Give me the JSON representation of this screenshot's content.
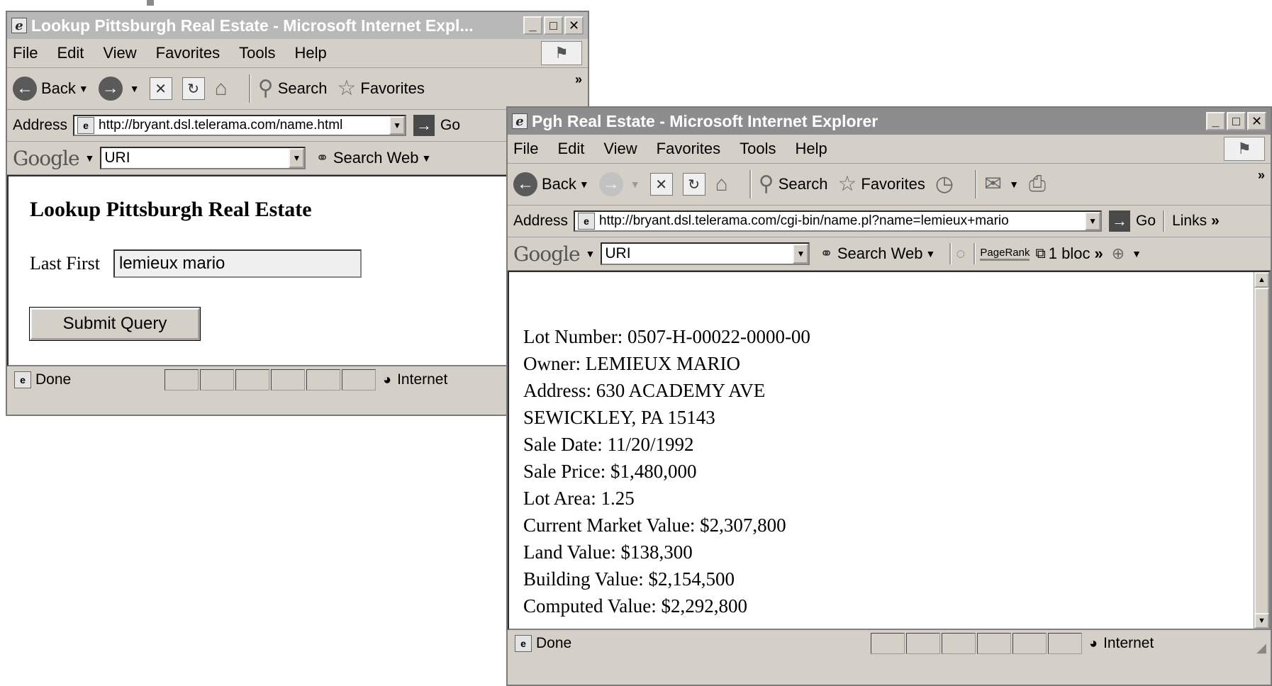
{
  "window1": {
    "title": "Lookup Pittsburgh Real Estate - Microsoft Internet Expl...",
    "menu": [
      "File",
      "Edit",
      "View",
      "Favorites",
      "Tools",
      "Help"
    ],
    "toolbar": {
      "back": "Back",
      "search": "Search",
      "favorites": "Favorites"
    },
    "address_label": "Address",
    "address_url": "http://bryant.dsl.telerama.com/name.html",
    "go_label": "Go",
    "google": {
      "logo": "Google",
      "query": "URI",
      "search_web": "Search Web"
    },
    "page": {
      "heading": "Lookup Pittsburgh Real Estate",
      "field_label": "Last First",
      "field_value": "lemieux mario",
      "submit_label": "Submit Query"
    },
    "status": {
      "text": "Done",
      "zone": "Internet"
    }
  },
  "window2": {
    "title": "Pgh Real Estate - Microsoft Internet Explorer",
    "menu": [
      "File",
      "Edit",
      "View",
      "Favorites",
      "Tools",
      "Help"
    ],
    "toolbar": {
      "back": "Back",
      "search": "Search",
      "favorites": "Favorites"
    },
    "address_label": "Address",
    "address_url": "http://bryant.dsl.telerama.com/cgi-bin/name.pl?name=lemieux+mario",
    "go_label": "Go",
    "links_label": "Links",
    "google": {
      "logo": "Google",
      "query": "URI",
      "search_web": "Search Web",
      "pagerank": "PageRank",
      "blocked": "1 bloc"
    },
    "records": [
      "Lot Number: 0507-H-00022-0000-00",
      "Owner: LEMIEUX MARIO",
      "Address: 630 ACADEMY AVE",
      "SEWICKLEY, PA 15143",
      "Sale Date: 11/20/1992",
      "Sale Price: $1,480,000",
      "Lot Area: 1.25",
      "Current Market Value: $2,307,800",
      "Land Value: $138,300",
      "Building Value: $2,154,500",
      "Computed Value: $2,292,800"
    ],
    "status": {
      "text": "Done",
      "zone": "Internet"
    }
  },
  "colors": {
    "title_active": "#8d8d8d",
    "title_inactive": "#b8b8b8",
    "chrome": "#d4d0c8"
  },
  "icons": [
    "ie-page-icon",
    "back-icon",
    "forward-icon",
    "stop-icon",
    "refresh-icon",
    "home-icon",
    "search-icon",
    "favorites-star-icon",
    "history-icon",
    "mail-icon",
    "print-icon",
    "go-arrow-icon",
    "binoculars-icon",
    "globe-icon",
    "windows-flag-icon"
  ]
}
